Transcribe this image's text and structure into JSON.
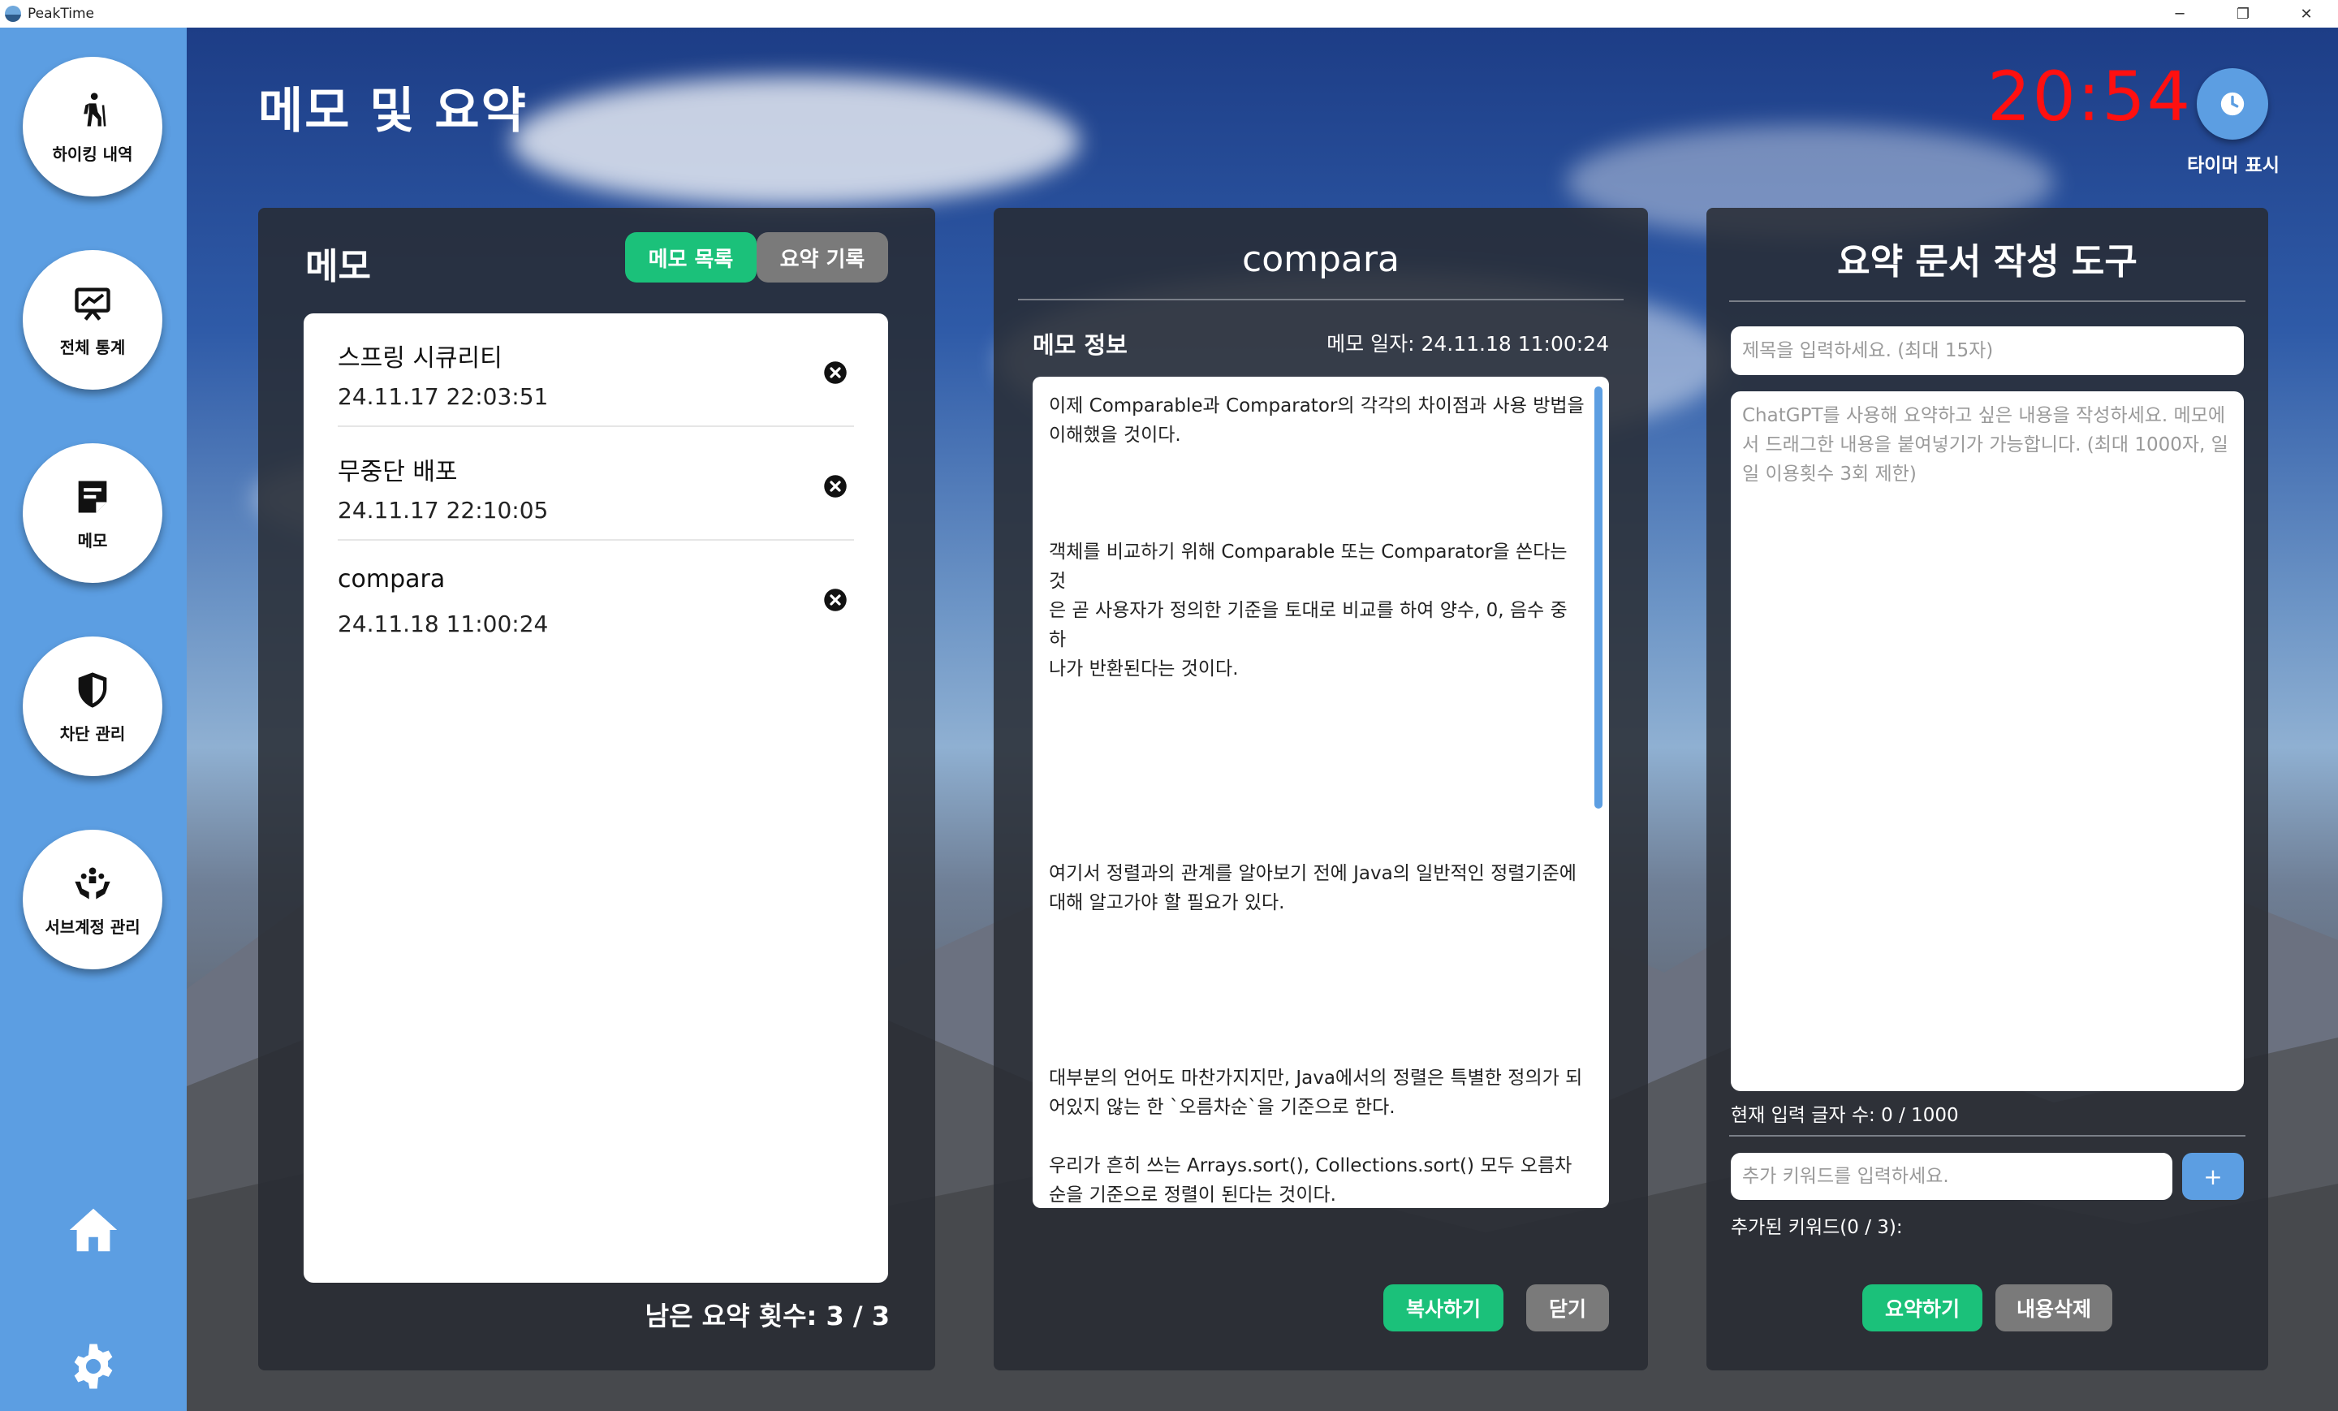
{
  "window": {
    "title": "PeakTime",
    "controls": {
      "minimize": "─",
      "restore": "❐",
      "close": "✕"
    }
  },
  "sidebar": {
    "items": [
      {
        "label": "하이킹 내역",
        "icon": "hiker-icon"
      },
      {
        "label": "전체 통계",
        "icon": "chart-board-icon"
      },
      {
        "label": "메모",
        "icon": "memo-icon"
      },
      {
        "label": "차단 관리",
        "icon": "shield-icon"
      },
      {
        "label": "서브계정 관리",
        "icon": "group-hands-icon"
      }
    ],
    "home_icon": "home-icon",
    "settings_icon": "gear-icon"
  },
  "header": {
    "title": "메모 및 요약",
    "clock": "20:54",
    "timer_label": "타이머 표시"
  },
  "memo_panel": {
    "heading": "메모",
    "tabs": {
      "list": "메모 목록",
      "history": "요약 기록"
    },
    "memos": [
      {
        "title": "스프링 시큐리티",
        "date": "24.11.17 22:03:51"
      },
      {
        "title": "무중단 배포",
        "date": "24.11.17 22:10:05"
      },
      {
        "title": "compara",
        "date": "24.11.18 11:00:24"
      }
    ],
    "remaining": "남은 요약 횟수: 3 / 3"
  },
  "detail_panel": {
    "title": "compara",
    "info_label": "메모 정보",
    "date_label": "메모 일자: 24.11.18 11:00:24",
    "content": "이제 Comparable과 Comparator의 각각의 차이점과 사용 방법을\n이해했을 것이다.\n\n\n\n객체를 비교하기 위해 Comparable 또는 Comparator을 쓴다는 것\n은 곧 사용자가 정의한 기준을 토대로 비교를 하여 양수, 0, 음수 중 하\n나가 반환된다는 것이다.\n\n\n\n\n\n\n여기서 정렬과의 관계를 알아보기 전에 Java의 일반적인 정렬기준에\n대해 알고가야 할 필요가 있다.\n\n\n\n\n\n대부분의 언어도 마찬가지지만, Java에서의 정렬은 특별한 정의가 되\n어있지 않는 한 `오름차순`을 기준으로 한다.\n\n우리가 흔히 쓰는 Arrays.sort(), Collections.sort() 모두 오름차\n순을 기준으로 정렬이 된다는 것이다.",
    "copy_button": "복사하기",
    "close_button": "닫기"
  },
  "tool_panel": {
    "title": "요약 문서 작성 도구",
    "title_placeholder": "제목을 입력하세요. (최대 15자)",
    "body_placeholder": "ChatGPT를 사용해 요약하고 싶은 내용을 작성하세요. 메모에서 드래그한 내용을 붙여넣기가 가능합니다. (최대 1000자, 일일 이용횟수 3회 제한)",
    "char_count": "현재 입력 글자 수: 0 / 1000",
    "keyword_placeholder": "추가 키워드를 입력하세요.",
    "keyword_add": "+",
    "keyword_count": "추가된 키워드(0 / 3):",
    "summarize_button": "요약하기",
    "clear_button": "내용삭제"
  },
  "colors": {
    "sidebar": "#5c9ee2",
    "accent_green": "#1bc17a",
    "gray_button": "#7a7a7a",
    "clock": "#ff1010",
    "panel": "#282b32"
  }
}
